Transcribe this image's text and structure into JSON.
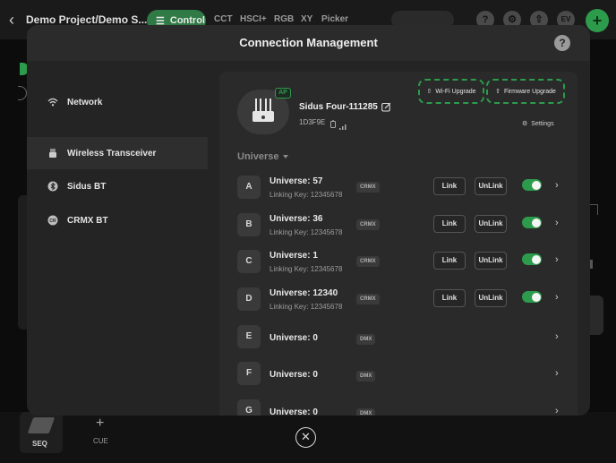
{
  "background": {
    "project_title": "Demo Project/Demo S...",
    "control_label": "Control",
    "tabs": [
      "CCT",
      "HSCI+",
      "RGB",
      "XY",
      "Picker"
    ],
    "avatar_initials": "EV",
    "seq_label": "SEQ",
    "cue_label": "CUE"
  },
  "modal": {
    "title": "Connection Management",
    "help_label": "?"
  },
  "sidebar": {
    "items": [
      {
        "label": "Network",
        "icon": "wifi-icon"
      },
      {
        "label": "Wireless Transceiver",
        "icon": "transceiver-icon"
      },
      {
        "label": "Sidus BT",
        "icon": "bluetooth-icon"
      },
      {
        "label": "CRMX BT",
        "icon": "crmx-icon"
      }
    ]
  },
  "device": {
    "name": "Sidus Four-111285",
    "id": "1D3F9E",
    "badge": "AP",
    "wifi_upgrade_label": "Wi-Fi Upgrade",
    "firmware_upgrade_label": "Firmware Upgrade",
    "settings_label": "Settings",
    "universe_label": "Universe"
  },
  "buttons": {
    "link": "Link",
    "unlink": "UnLink"
  },
  "universes": [
    {
      "letter": "A",
      "name": "Universe: 57",
      "key": "Linking Key: 12345678",
      "protocol": "CRMX",
      "toggle_on": true
    },
    {
      "letter": "B",
      "name": "Universe: 36",
      "key": "Linking Key: 12345678",
      "protocol": "CRMX",
      "toggle_on": true
    },
    {
      "letter": "C",
      "name": "Universe: 1",
      "key": "Linking Key: 12345678",
      "protocol": "CRMX",
      "toggle_on": true
    },
    {
      "letter": "D",
      "name": "Universe: 12340",
      "key": "Linking Key: 12345678",
      "protocol": "CRMX",
      "toggle_on": true
    },
    {
      "letter": "E",
      "name": "Universe: 0",
      "protocol": "DMX"
    },
    {
      "letter": "F",
      "name": "Universe: 0",
      "protocol": "DMX"
    },
    {
      "letter": "G",
      "name": "Universe: 0",
      "protocol": "DMX"
    }
  ],
  "colors": {
    "accent": "#2c9b4c",
    "modal_bg": "#242424",
    "panel_bg": "#2a2a2a"
  }
}
